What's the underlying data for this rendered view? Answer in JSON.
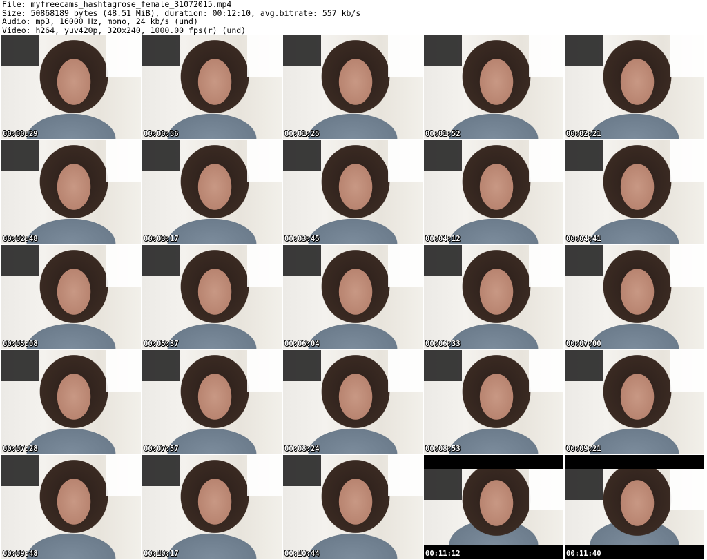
{
  "header": {
    "file": "File: myfreecams_hashtagrose_female_31072015.mp4",
    "size": "Size: 50868189 bytes (48.51 MiB), duration: 00:12:10, avg.bitrate: 557 kb/s",
    "audio": "Audio: mp3, 16000 Hz, mono, 24 kb/s (und)",
    "video": "Video: h264, yuv420p, 320x240, 1000.00 fps(r) (und)"
  },
  "thumbnails": [
    {
      "timestamp": "00:00:29"
    },
    {
      "timestamp": "00:00:56"
    },
    {
      "timestamp": "00:01:25"
    },
    {
      "timestamp": "00:01:52"
    },
    {
      "timestamp": "00:02:21"
    },
    {
      "timestamp": "00:02:48"
    },
    {
      "timestamp": "00:03:17"
    },
    {
      "timestamp": "00:03:45"
    },
    {
      "timestamp": "00:04:12"
    },
    {
      "timestamp": "00:04:41"
    },
    {
      "timestamp": "00:05:08"
    },
    {
      "timestamp": "00:05:37"
    },
    {
      "timestamp": "00:06:04"
    },
    {
      "timestamp": "00:06:33"
    },
    {
      "timestamp": "00:07:00"
    },
    {
      "timestamp": "00:07:28"
    },
    {
      "timestamp": "00:07:57"
    },
    {
      "timestamp": "00:08:24"
    },
    {
      "timestamp": "00:08:53"
    },
    {
      "timestamp": "00:09:21"
    },
    {
      "timestamp": "00:09:48"
    },
    {
      "timestamp": "00:10:17"
    },
    {
      "timestamp": "00:10:44"
    },
    {
      "timestamp": "00:11:12"
    },
    {
      "timestamp": "00:11:40"
    }
  ]
}
